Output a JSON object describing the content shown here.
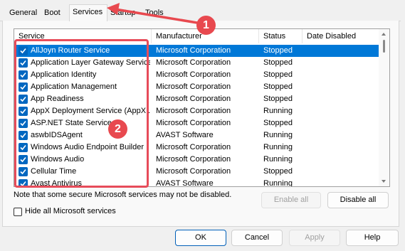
{
  "tabs": [
    "General",
    "Boot",
    "Services",
    "Startup",
    "Tools"
  ],
  "active_tab": "Services",
  "columns": [
    "Service",
    "Manufacturer",
    "Status",
    "Date Disabled"
  ],
  "rows": [
    {
      "service": "AllJoyn Router Service",
      "manufacturer": "Microsoft Corporation",
      "status": "Stopped",
      "checked": true,
      "selected": true
    },
    {
      "service": "Application Layer Gateway Service",
      "manufacturer": "Microsoft Corporation",
      "status": "Stopped",
      "checked": true
    },
    {
      "service": "Application Identity",
      "manufacturer": "Microsoft Corporation",
      "status": "Stopped",
      "checked": true
    },
    {
      "service": "Application Management",
      "manufacturer": "Microsoft Corporation",
      "status": "Stopped",
      "checked": true
    },
    {
      "service": "App Readiness",
      "manufacturer": "Microsoft Corporation",
      "status": "Stopped",
      "checked": true
    },
    {
      "service": "AppX Deployment Service (AppX...",
      "manufacturer": "Microsoft Corporation",
      "status": "Running",
      "checked": true
    },
    {
      "service": "ASP.NET State Service",
      "manufacturer": "Microsoft Corporation",
      "status": "Stopped",
      "checked": true
    },
    {
      "service": "aswbIDSAgent",
      "manufacturer": "AVAST Software",
      "status": "Running",
      "checked": true
    },
    {
      "service": "Windows Audio Endpoint Builder",
      "manufacturer": "Microsoft Corporation",
      "status": "Running",
      "checked": true
    },
    {
      "service": "Windows Audio",
      "manufacturer": "Microsoft Corporation",
      "status": "Running",
      "checked": true
    },
    {
      "service": "Cellular Time",
      "manufacturer": "Microsoft Corporation",
      "status": "Stopped",
      "checked": true
    },
    {
      "service": "Avast Antivirus",
      "manufacturer": "AVAST Software",
      "status": "Running",
      "checked": true
    }
  ],
  "note": "Note that some secure Microsoft services may not be disabled.",
  "buttons": {
    "enable_all": "Enable all",
    "disable_all": "Disable all",
    "ok": "OK",
    "cancel": "Cancel",
    "apply": "Apply",
    "help": "Help"
  },
  "hide_ms": {
    "label": "Hide all Microsoft services",
    "checked": false
  },
  "annotations": {
    "badge1": "1",
    "badge2": "2",
    "color": "#e8494f"
  },
  "colors": {
    "selection": "#0078d7",
    "checkbox": "#0067c0"
  }
}
